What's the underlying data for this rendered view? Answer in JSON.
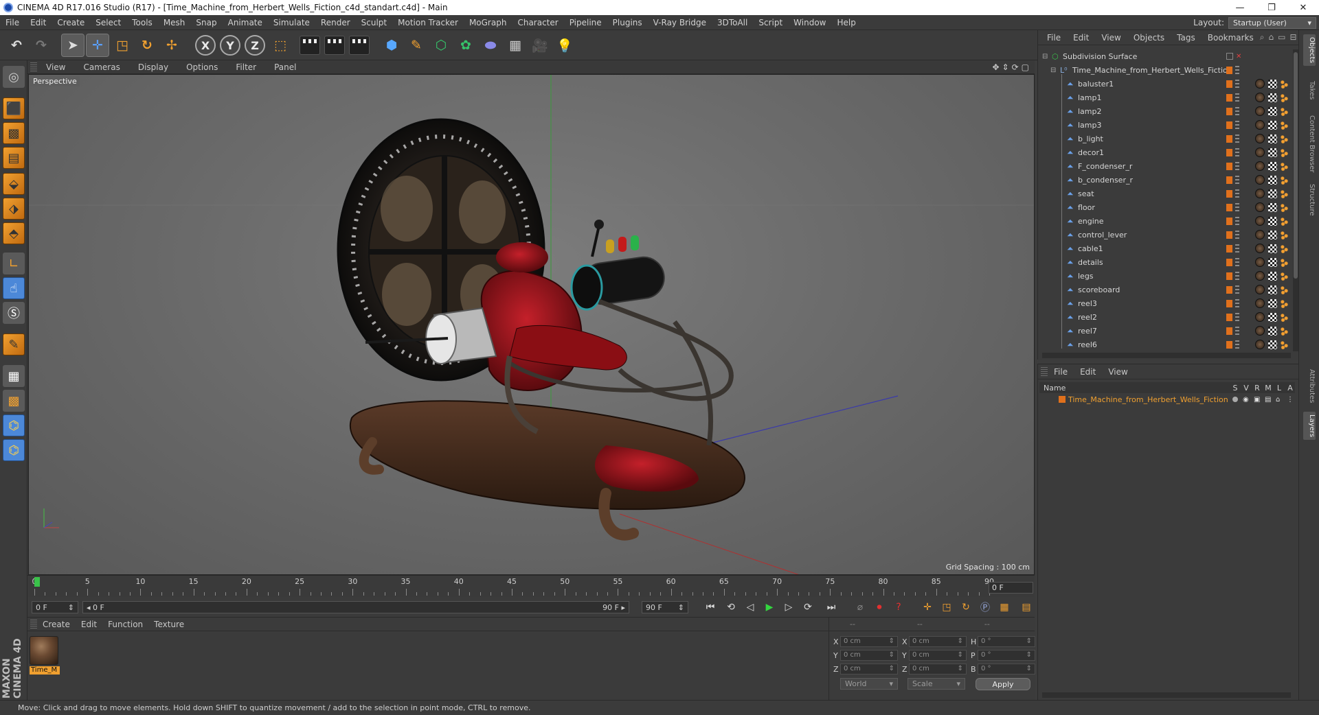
{
  "window": {
    "title": "CINEMA 4D R17.016 Studio (R17) - [Time_Machine_from_Herbert_Wells_Fiction_c4d_standart.c4d] - Main",
    "minimize": "—",
    "restore": "❐",
    "close": "✕"
  },
  "menu": [
    "File",
    "Edit",
    "Create",
    "Select",
    "Tools",
    "Mesh",
    "Snap",
    "Animate",
    "Simulate",
    "Render",
    "Sculpt",
    "Motion Tracker",
    "MoGraph",
    "Character",
    "Pipeline",
    "Plugins",
    "V-Ray Bridge",
    "3DToAll",
    "Script",
    "Window",
    "Help"
  ],
  "layout": {
    "label": "Layout:",
    "value": "Startup (User)"
  },
  "viewport": {
    "menu": [
      "View",
      "Cameras",
      "Display",
      "Options",
      "Filter",
      "Panel"
    ],
    "label": "Perspective",
    "grid_spacing": "Grid Spacing : 100 cm"
  },
  "timeline": {
    "ticks": [
      "0",
      "5",
      "10",
      "15",
      "20",
      "25",
      "30",
      "35",
      "40",
      "45",
      "50",
      "55",
      "60",
      "65",
      "70",
      "75",
      "80",
      "85",
      "90"
    ],
    "current_frame": "0 F"
  },
  "transport": {
    "start_field": "0 F",
    "range_start": "0 F",
    "range_end": "90 F",
    "end_field": "90 F"
  },
  "material_manager": {
    "menu": [
      "Create",
      "Edit",
      "Function",
      "Texture"
    ],
    "material_name": "Time_M"
  },
  "coordinates": {
    "header": [
      "--",
      "--",
      "--"
    ],
    "rows": [
      {
        "a": "X",
        "av": "0 cm",
        "b": "X",
        "bv": "0 cm",
        "c": "H",
        "cv": "0 °"
      },
      {
        "a": "Y",
        "av": "0 cm",
        "b": "Y",
        "bv": "0 cm",
        "c": "P",
        "cv": "0 °"
      },
      {
        "a": "Z",
        "av": "0 cm",
        "b": "Z",
        "bv": "0 cm",
        "c": "B",
        "cv": "0 °"
      }
    ],
    "space": "World",
    "mode": "Scale",
    "apply": "Apply"
  },
  "status": "Move: Click and drag to move elements. Hold down SHIFT to quantize movement / add to the selection in point mode, CTRL to remove.",
  "object_manager": {
    "menu": [
      "File",
      "Edit",
      "View",
      "Objects",
      "Tags",
      "Bookmarks"
    ],
    "root": "Subdivision Surface",
    "group": "Time_Machine_from_Herbert_Wells_Fiction",
    "objects": [
      "baluster1",
      "lamp1",
      "lamp2",
      "lamp3",
      "b_light",
      "decor1",
      "F_condenser_r",
      "b_condenser_r",
      "seat",
      "floor",
      "engine",
      "control_lever",
      "cable1",
      "details",
      "legs",
      "scoreboard",
      "reel3",
      "reel2",
      "reel7",
      "reel6"
    ]
  },
  "layer_manager": {
    "menu": [
      "File",
      "Edit",
      "View"
    ],
    "columns": {
      "name": "Name",
      "s": "S",
      "v": "V",
      "r": "R",
      "m": "M",
      "l": "L",
      "a": "A"
    },
    "layer_name": "Time_Machine_from_Herbert_Wells_Fiction"
  },
  "side_tabs": [
    "Objects",
    "Takes",
    "Content Browser",
    "Structure",
    "Attributes",
    "Layers"
  ],
  "logo": "MAXON CINEMA 4D",
  "colors": {
    "accent": "#f0a030",
    "playhead": "#3ac24a",
    "layer": "#e0701c"
  }
}
